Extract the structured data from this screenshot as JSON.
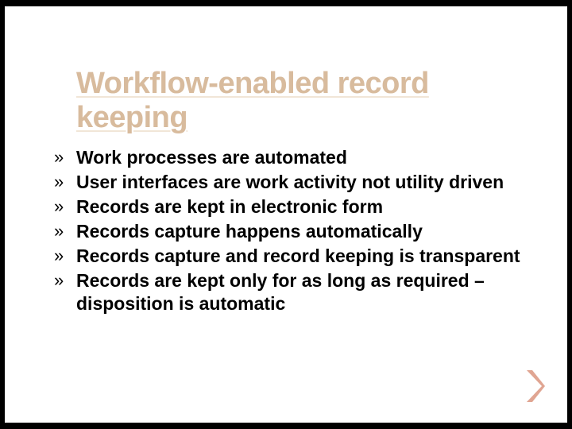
{
  "title": "Workflow-enabled record keeping",
  "bullets": [
    "Work processes are automated",
    "User interfaces are work activity not utility driven",
    "Records are kept in electronic form",
    "Records capture happens automatically",
    "Records capture and record keeping is transparent",
    "Records are kept only for as long as required – disposition is automatic"
  ],
  "bullet_marker": "»"
}
